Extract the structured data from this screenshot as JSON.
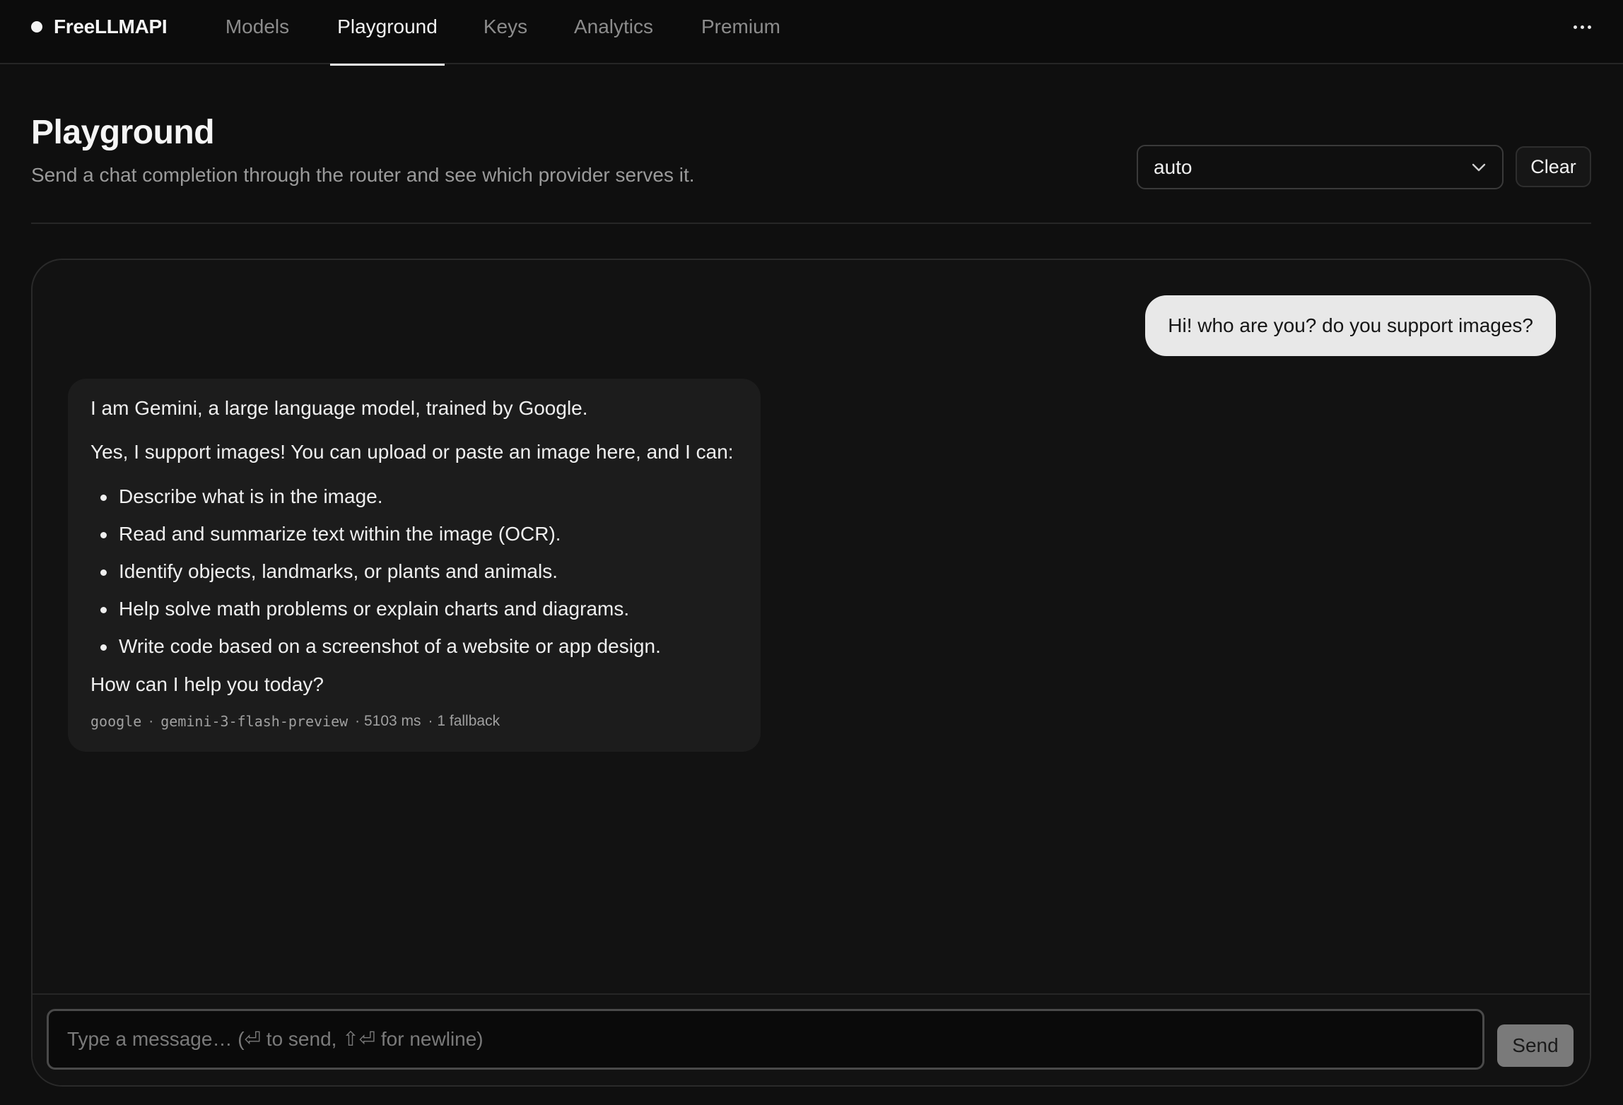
{
  "brand": {
    "name": "FreeLLMAPI"
  },
  "nav": {
    "tabs": [
      {
        "label": "Models"
      },
      {
        "label": "Playground",
        "active": true
      },
      {
        "label": "Keys"
      },
      {
        "label": "Analytics"
      },
      {
        "label": "Premium"
      }
    ],
    "more_icon": "more-horizontal-icon"
  },
  "header": {
    "title": "Playground",
    "subtitle": "Send a chat completion through the router and see which provider serves it.",
    "model_select": {
      "value": "auto"
    },
    "clear_label": "Clear"
  },
  "chat": {
    "messages": [
      {
        "role": "user",
        "text": "Hi! who are you? do you support images?"
      },
      {
        "role": "assistant",
        "intro": "I am Gemini, a large language model, trained by Google.",
        "lead": "Yes, I support images! You can upload or paste an image here, and I can:",
        "bullets": [
          "Describe what is in the image.",
          "Read and summarize text within the image (OCR).",
          "Identify objects, landmarks, or plants and animals.",
          "Help solve math problems or explain charts and diagrams.",
          "Write code based on a screenshot of a website or app design."
        ],
        "closing": "How can I help you today?",
        "meta": {
          "provider": "google",
          "separator": "·",
          "model": "gemini-3-flash-preview",
          "latency": "· 5103 ms",
          "fallback": "· 1 fallback"
        }
      }
    ]
  },
  "composer": {
    "placeholder": "Type a message… (⏎ to send, ⇧⏎ for newline)",
    "value": "",
    "send_label": "Send"
  },
  "colors": {
    "background": "#0f0f0f",
    "panel": "#121212",
    "user_bubble": "#e8e8e8",
    "assistant_bubble": "#1c1c1c",
    "send_button": "#7a7a7a"
  }
}
